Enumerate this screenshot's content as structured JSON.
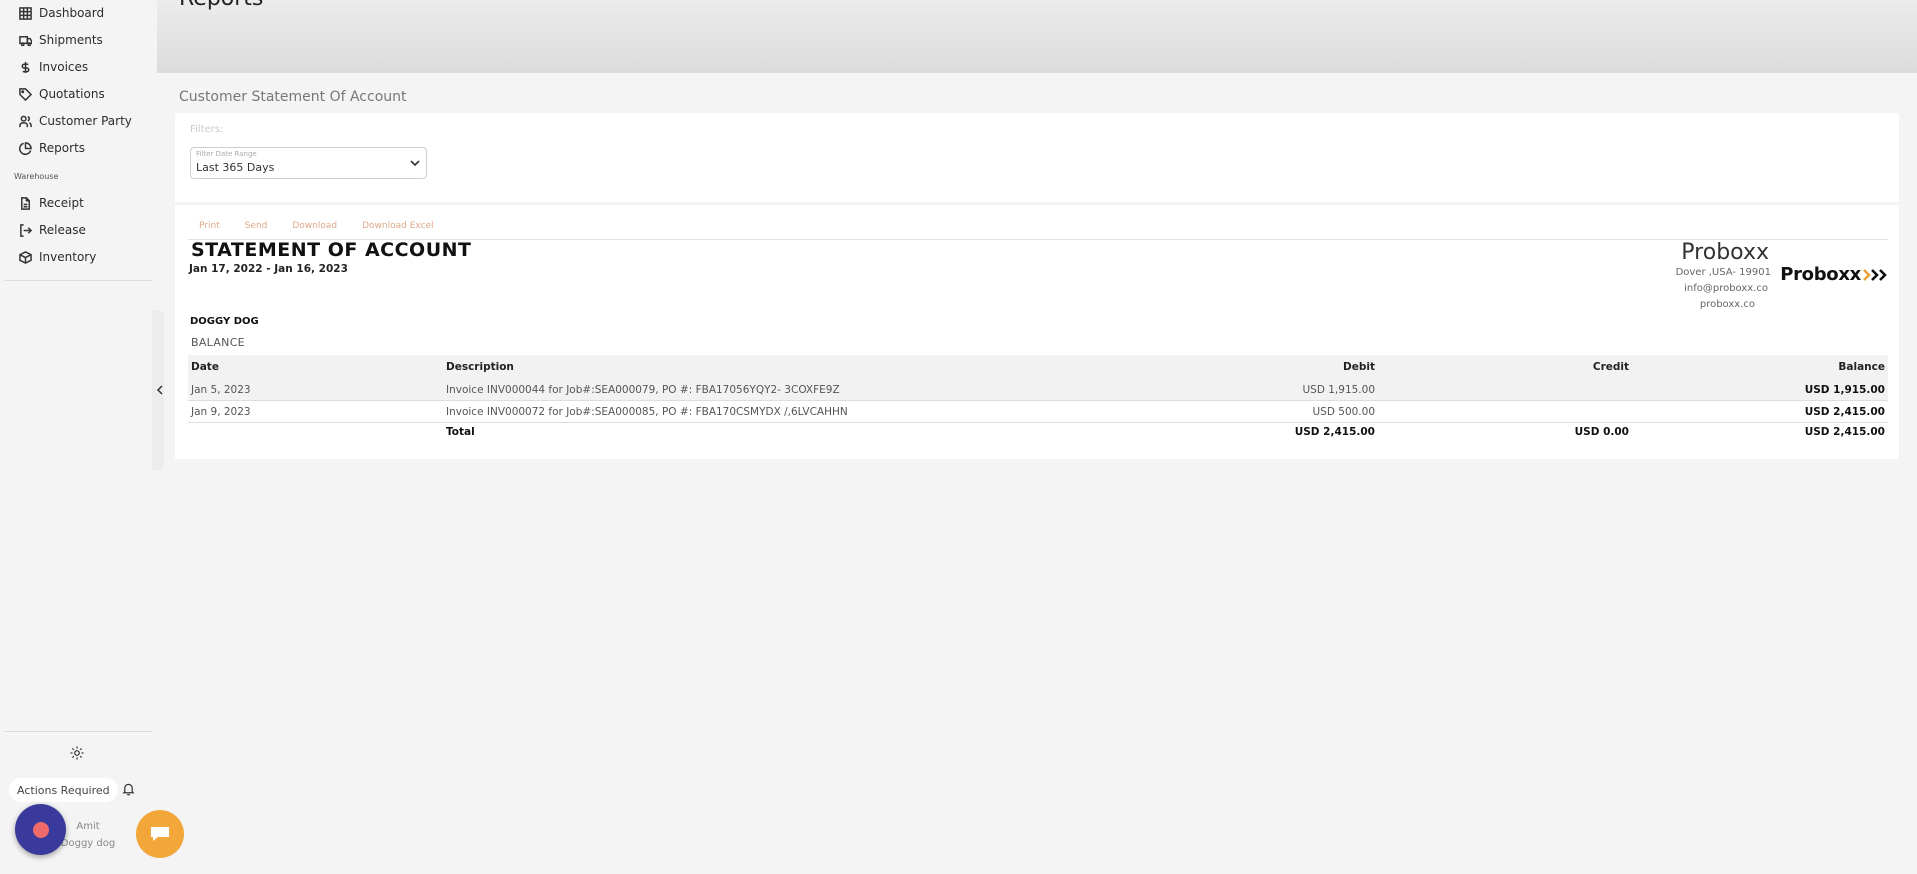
{
  "sidebar": {
    "items": [
      {
        "label": "Dashboard",
        "icon": "grid-icon"
      },
      {
        "label": "Shipments",
        "icon": "truck-icon"
      },
      {
        "label": "Invoices",
        "icon": "dollar-icon"
      },
      {
        "label": "Quotations",
        "icon": "tag-icon"
      },
      {
        "label": "Customer Party",
        "icon": "users-icon"
      },
      {
        "label": "Reports",
        "icon": "pie-chart-icon"
      }
    ],
    "section_label": "Warehouse",
    "warehouse_items": [
      {
        "label": "Receipt",
        "icon": "file-icon"
      },
      {
        "label": "Release",
        "icon": "log-out-icon"
      },
      {
        "label": "Inventory",
        "icon": "box-icon"
      }
    ],
    "actions_label": "Actions Required",
    "user": {
      "name": "Amit",
      "company": "Doggy dog"
    }
  },
  "header": {
    "title": "Reports"
  },
  "section_title": "Customer Statement Of Account",
  "filters": {
    "label": "Filters:",
    "date_range_label": "Filter Date Range",
    "date_range_value": "Last 365 Days"
  },
  "toolbar": {
    "print": "Print",
    "send": "Send",
    "download": "Download",
    "download_excel": "Download Excel"
  },
  "statement": {
    "title": "STATEMENT OF ACCOUNT",
    "date_range": "Jan 17, 2022 - Jan 16, 2023",
    "customer": "DOGGY DOG",
    "balance_label": "BALANCE"
  },
  "company": {
    "name": "Proboxx",
    "address": "Dover ,USA- 19901",
    "email": "info@proboxx.co",
    "website": "proboxx.co",
    "logo_text": "Proboxx"
  },
  "table": {
    "columns": {
      "date": "Date",
      "description": "Description",
      "debit": "Debit",
      "credit": "Credit",
      "balance": "Balance"
    },
    "rows": [
      {
        "date": "Jan 5, 2023",
        "description": "Invoice INV000044 for Job#:SEA000079, PO #: FBA17056YQY2- 3COXFE9Z",
        "debit": "USD 1,915.00",
        "credit": "",
        "balance": "USD 1,915.00"
      },
      {
        "date": "Jan 9, 2023",
        "description": "Invoice INV000072 for Job#:SEA000085, PO #: FBA170CSMYDX /,6LVCAHHN",
        "debit": "USD 500.00",
        "credit": "",
        "balance": "USD 2,415.00"
      }
    ],
    "total": {
      "label": "Total",
      "debit": "USD 2,415.00",
      "credit": "USD 0.00",
      "balance": "USD 2,415.00"
    }
  },
  "colors": {
    "accent_link": "#e0a88a",
    "fab_purple": "#3a3a9c",
    "fab_dot": "#f06a6a",
    "chat_button": "#f3a63a"
  }
}
